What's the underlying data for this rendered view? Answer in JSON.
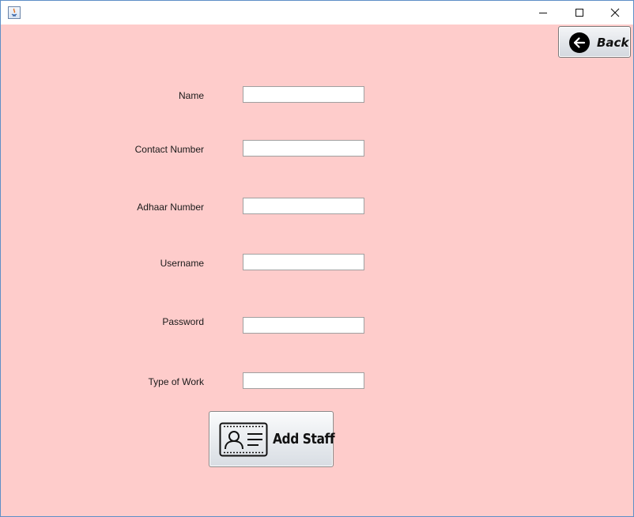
{
  "window": {
    "icon": "java-app-icon",
    "controls": {
      "minimize": "minimize-icon",
      "maximize": "maximize-icon",
      "close": "close-icon"
    }
  },
  "toolbar": {
    "back_label": "Back",
    "back_icon": "arrow-left-circle-icon"
  },
  "form": {
    "fields": [
      {
        "label": "Name",
        "value": ""
      },
      {
        "label": "Contact Number",
        "value": ""
      },
      {
        "label": "Adhaar Number",
        "value": ""
      },
      {
        "label": "Username",
        "value": ""
      },
      {
        "label": "Password",
        "value": ""
      },
      {
        "label": "Type of Work",
        "value": ""
      }
    ],
    "submit_label": "Add Staff",
    "submit_icon": "id-card-icon"
  },
  "colors": {
    "background": "#fecccb",
    "titlebar": "#ffffff",
    "window_border": "#5e8fc7"
  }
}
